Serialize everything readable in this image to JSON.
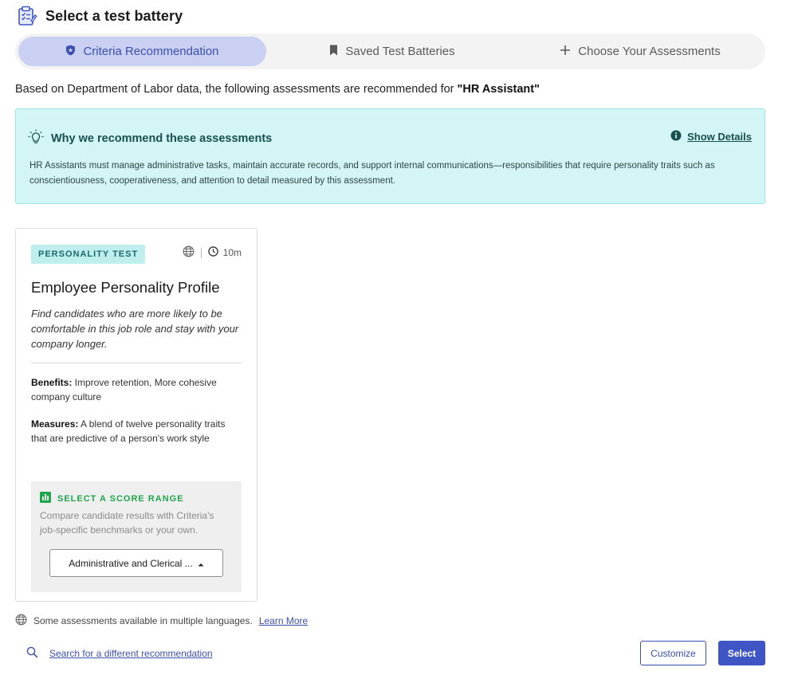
{
  "page": {
    "title": "Select a test battery"
  },
  "tabs": [
    {
      "label": "Criteria Recommendation",
      "icon": "shield-icon",
      "active": true
    },
    {
      "label": "Saved Test Batteries",
      "icon": "bookmark-icon",
      "active": false
    },
    {
      "label": "Choose Your Assessments",
      "icon": "plus-icon",
      "active": false
    }
  ],
  "intro": {
    "prefix": "Based on Department of Labor data, the following assessments are recommended for ",
    "role": "\"HR Assistant\""
  },
  "why": {
    "title": "Why we recommend these assessments",
    "details_link": "Show Details",
    "body": "HR Assistants must manage administrative tasks, maintain accurate records, and support internal communications—responsibilities that require personality traits such as conscientiousness, cooperativeness, and attention to detail measured by this assessment."
  },
  "card": {
    "badge": "PERSONALITY TEST",
    "duration": "10m",
    "title": "Employee Personality Profile",
    "description": "Find candidates who are more likely to be comfortable in this job role and stay with your company longer.",
    "benefits_label": "Benefits:",
    "benefits": " Improve retention, More cohesive company culture",
    "measures_label": "Measures:",
    "measures": " A blend of twelve personality traits that are predictive of a person's work style",
    "score": {
      "label": "SELECT A SCORE RANGE",
      "help": "Compare candidate results with Criteria's job-specific benchmarks or your own.",
      "selected": "Administrative and Clerical ..."
    }
  },
  "footer": {
    "languages_note": "Some assessments available in multiple languages.",
    "learn_more": "Learn More",
    "search_link": "Search for a different recommendation",
    "customize": "Customize",
    "select": "Select"
  },
  "colors": {
    "accent": "#3f55c6",
    "tab_active_bg": "#c9d0f1",
    "info_bg": "#d4f5f5",
    "success": "#1fa64d"
  }
}
